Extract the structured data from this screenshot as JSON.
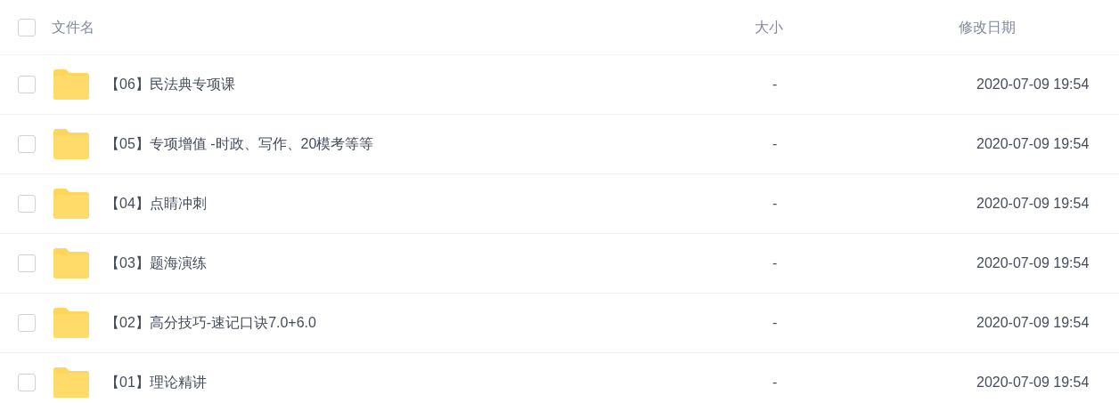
{
  "table": {
    "select_all": {
      "checked": false
    },
    "columns": [
      "文件名",
      "大小",
      "修改日期"
    ],
    "rows": [
      {
        "kind": "folder",
        "name": "【06】民法典专项课",
        "size": "-",
        "modified": "2020-07-09 19:54",
        "checked": false
      },
      {
        "kind": "folder",
        "name": "【05】专项增值 -时政、写作、20模考等等",
        "size": "-",
        "modified": "2020-07-09 19:54",
        "checked": false
      },
      {
        "kind": "folder",
        "name": "【04】点睛冲刺",
        "size": "-",
        "modified": "2020-07-09 19:54",
        "checked": false
      },
      {
        "kind": "folder",
        "name": "【03】题海演练",
        "size": "-",
        "modified": "2020-07-09 19:54",
        "checked": false
      },
      {
        "kind": "folder",
        "name": "【02】高分技巧-速记口诀7.0+6.0",
        "size": "-",
        "modified": "2020-07-09 19:54",
        "checked": false
      },
      {
        "kind": "folder",
        "name": "【01】理论精讲",
        "size": "-",
        "modified": "2020-07-09 19:54",
        "checked": false
      }
    ]
  }
}
